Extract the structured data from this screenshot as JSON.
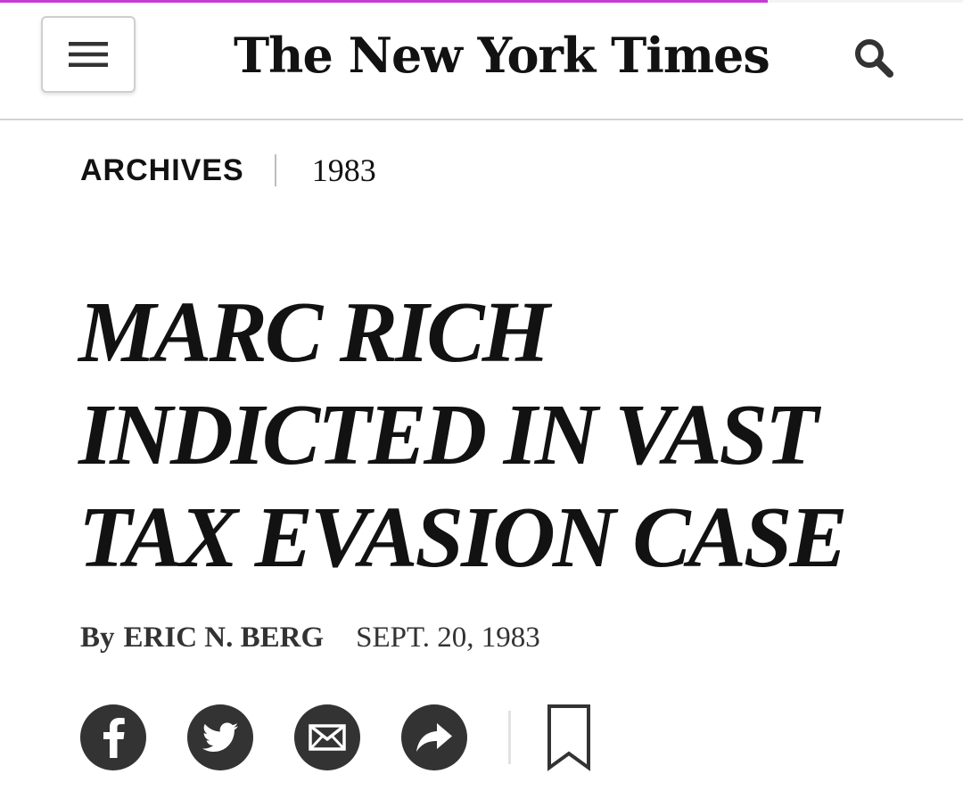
{
  "page_load_progress": 0.797,
  "colors": {
    "progress": "#c63ad6",
    "text": "#121212",
    "icon_circle": "#333333"
  },
  "header": {
    "logo_text": "The New York Times",
    "menu_icon": "hamburger-icon",
    "search_icon": "search-icon"
  },
  "kicker": {
    "section": "ARCHIVES",
    "year": "1983"
  },
  "article": {
    "headline_lines": [
      "MARC RICH",
      "INDICTED IN VAST",
      "TAX EVASION CASE"
    ],
    "byline_prefix": "By",
    "author": "ERIC N. BERG",
    "date": "SEPT. 20, 1983"
  },
  "share": {
    "buttons": [
      {
        "icon": "facebook-icon"
      },
      {
        "icon": "twitter-icon"
      },
      {
        "icon": "email-icon"
      },
      {
        "icon": "share-arrow-icon"
      }
    ],
    "bookmark_icon": "bookmark-icon"
  }
}
